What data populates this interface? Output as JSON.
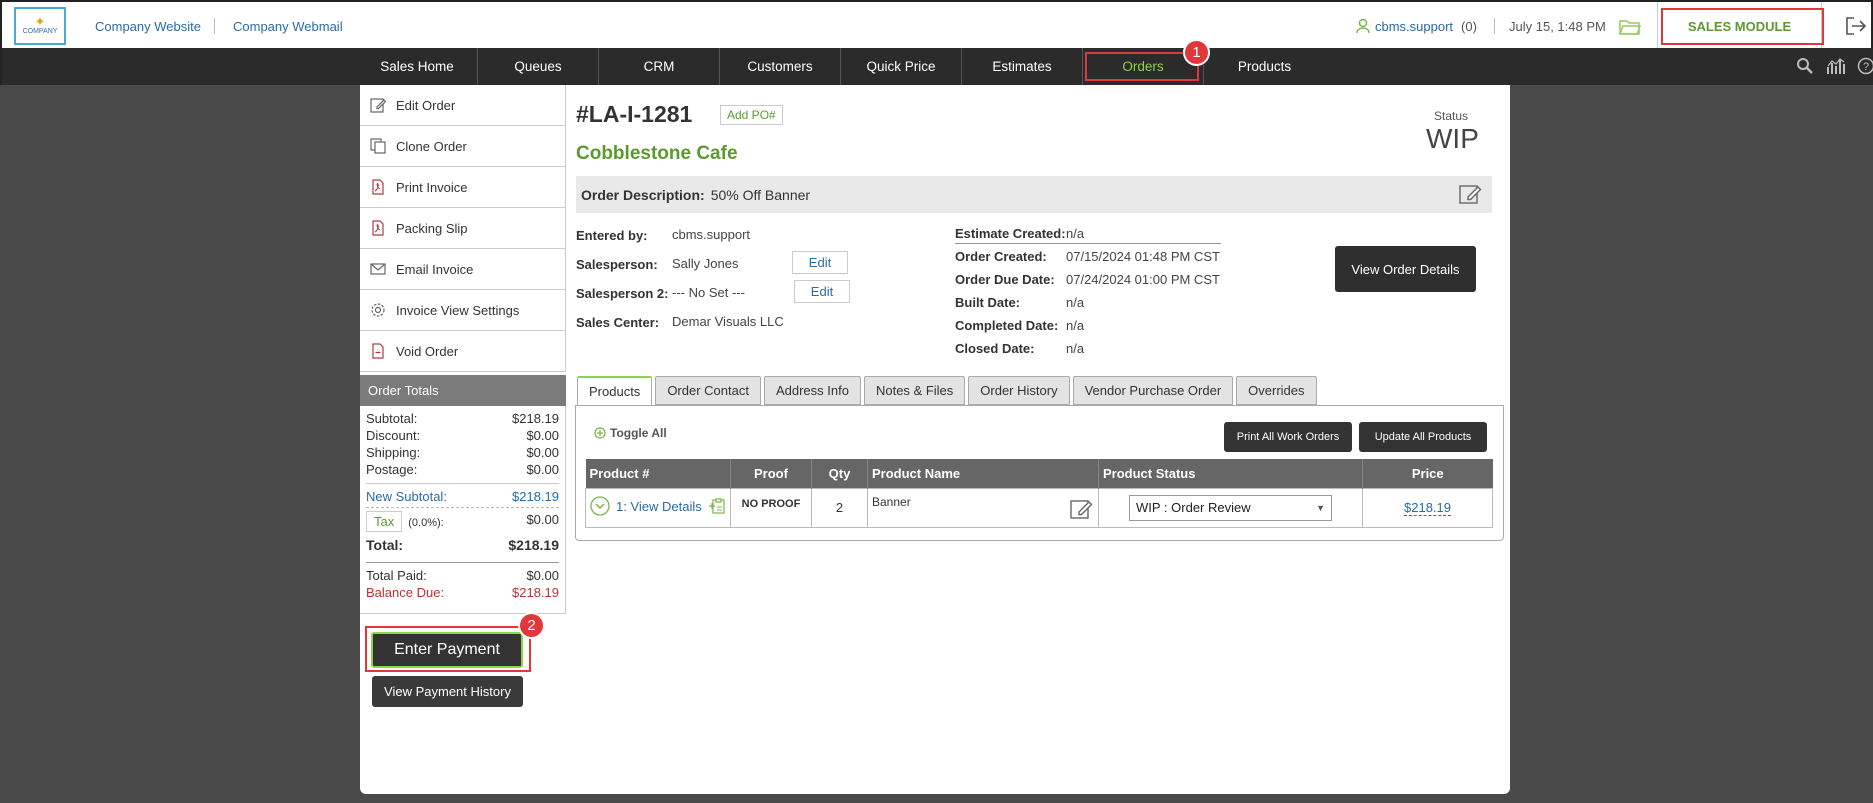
{
  "header": {
    "logo_text": "COMPANY",
    "links": [
      "Company Website",
      "Company Webmail"
    ],
    "user": "cbms.support",
    "user_count": "(0)",
    "datetime": "July 15, 1:48 PM",
    "module": "SALES MODULE"
  },
  "nav": {
    "items": [
      "Sales Home",
      "Queues",
      "CRM",
      "Customers",
      "Quick Price",
      "Estimates",
      "Orders",
      "Products"
    ],
    "active": "Orders"
  },
  "badges": [
    "1",
    "2"
  ],
  "sidebar": {
    "actions": [
      "Edit Order",
      "Clone Order",
      "Print Invoice",
      "Packing Slip",
      "Email Invoice",
      "Invoice View Settings",
      "Void Order"
    ],
    "totals_title": "Order Totals",
    "totals": {
      "subtotal_label": "Subtotal:",
      "subtotal": "$218.19",
      "discount_label": "Discount:",
      "discount": "$0.00",
      "shipping_label": "Shipping:",
      "shipping": "$0.00",
      "postage_label": "Postage:",
      "postage": "$0.00",
      "new_subtotal_label": "New Subtotal:",
      "new_subtotal": "$218.19",
      "tax_button": "Tax",
      "tax_rate": "(0.0%):",
      "tax": "$0.00",
      "total_label": "Total:",
      "total": "$218.19",
      "paid_label": "Total Paid:",
      "paid": "$0.00",
      "due_label": "Balance Due:",
      "due": "$218.19"
    },
    "enter_payment": "Enter Payment",
    "view_history": "View Payment History"
  },
  "order": {
    "number": "#LA-I-1281",
    "add_po": "Add PO#",
    "customer": "Cobblestone Cafe",
    "status_label": "Status",
    "status": "WIP",
    "description_label": "Order Description:",
    "description": "50% Off Banner",
    "entered_by_label": "Entered by:",
    "entered_by": "cbms.support",
    "salesperson_label": "Salesperson:",
    "salesperson": "Sally Jones",
    "salesperson2_label": "Salesperson 2:",
    "salesperson2": "--- No Set ---",
    "sales_center_label": "Sales Center:",
    "sales_center": "Demar Visuals LLC",
    "edit": "Edit",
    "estimate_created_label": "Estimate Created:",
    "estimate_created": "n/a",
    "order_created_label": "Order Created:",
    "order_created": "07/15/2024 01:48 PM CST",
    "order_due_label": "Order Due Date:",
    "order_due": "07/24/2024 01:00 PM CST",
    "built_label": "Built Date:",
    "built": "n/a",
    "completed_label": "Completed Date:",
    "completed": "n/a",
    "closed_label": "Closed Date:",
    "closed": "n/a",
    "view_details": "View Order Details"
  },
  "tabs": [
    "Products",
    "Order Contact",
    "Address Info",
    "Notes & Files",
    "Order History",
    "Vendor Purchase Order",
    "Overrides"
  ],
  "products": {
    "toggle_all": "Toggle All",
    "print_all": "Print All Work Orders",
    "update_all": "Update All Products",
    "columns": [
      "Product #",
      "Proof",
      "Qty",
      "Product Name",
      "Product Status",
      "Price"
    ],
    "rows": [
      {
        "num": "1: View Details",
        "proof": "NO PROOF",
        "qty": "2",
        "name": "Banner",
        "status": "WIP : Order Review",
        "price": "$218.19"
      }
    ]
  }
}
